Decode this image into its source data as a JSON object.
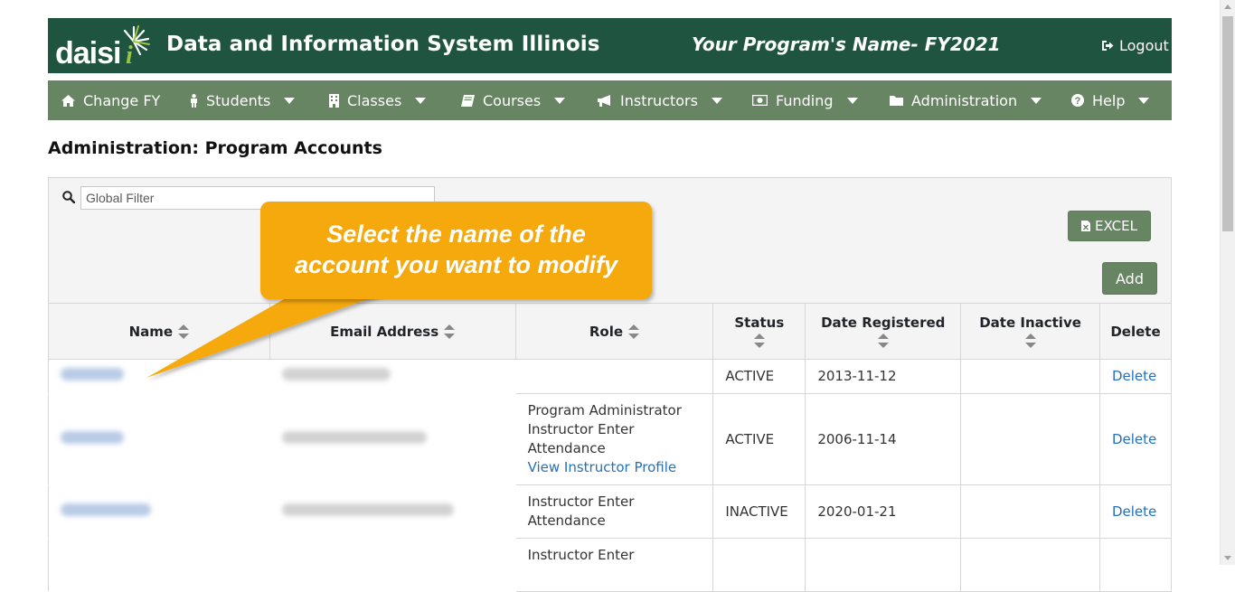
{
  "header": {
    "logo_text": "daisi",
    "app_title": "Data and Information System Illinois",
    "program_name": "Your Program's Name- FY2021",
    "logout_label": "Logout"
  },
  "nav": {
    "items": [
      {
        "label": "Change FY",
        "icon": "home-icon"
      },
      {
        "label": "Students",
        "icon": "person-icon"
      },
      {
        "label": "Classes",
        "icon": "building-icon"
      },
      {
        "label": "Courses",
        "icon": "book-icon"
      },
      {
        "label": "Instructors",
        "icon": "bullhorn-icon"
      },
      {
        "label": "Funding",
        "icon": "money-icon"
      },
      {
        "label": "Administration",
        "icon": "folder-icon"
      },
      {
        "label": "Help",
        "icon": "question-circle-icon"
      }
    ]
  },
  "page": {
    "heading": "Administration: Program Accounts"
  },
  "toolbar": {
    "filter_placeholder": "Global Filter",
    "excel_label": "EXCEL",
    "add_label": "Add"
  },
  "table": {
    "columns": [
      "Name",
      "Email Address",
      "Role",
      "Status",
      "Date Registered",
      "Date Inactive",
      "Delete"
    ],
    "rows": [
      {
        "role": [],
        "profile_link": "",
        "status": "ACTIVE",
        "date_registered": "2013-11-12",
        "date_inactive": "",
        "delete": "Delete"
      },
      {
        "role": [
          "Program Administrator",
          "Instructor Enter",
          "Attendance"
        ],
        "profile_link": "View Instructor Profile",
        "status": "ACTIVE",
        "date_registered": "2006-11-14",
        "date_inactive": "",
        "delete": "Delete"
      },
      {
        "role": [
          "Instructor Enter",
          "Attendance"
        ],
        "profile_link": "",
        "status": "INACTIVE",
        "date_registered": "2020-01-21",
        "date_inactive": "",
        "delete": "Delete"
      },
      {
        "role": [
          "Instructor Enter"
        ],
        "profile_link": "",
        "status": "",
        "date_registered": "",
        "date_inactive": "",
        "delete": ""
      }
    ]
  },
  "callout": {
    "line1": "Select the name of the",
    "line2": "account you want to modify"
  },
  "colors": {
    "header_bg": "#1f5440",
    "nav_bg": "#678563",
    "button_bg": "#678563",
    "callout_bg": "#f5a90d",
    "link": "#2770b8"
  }
}
